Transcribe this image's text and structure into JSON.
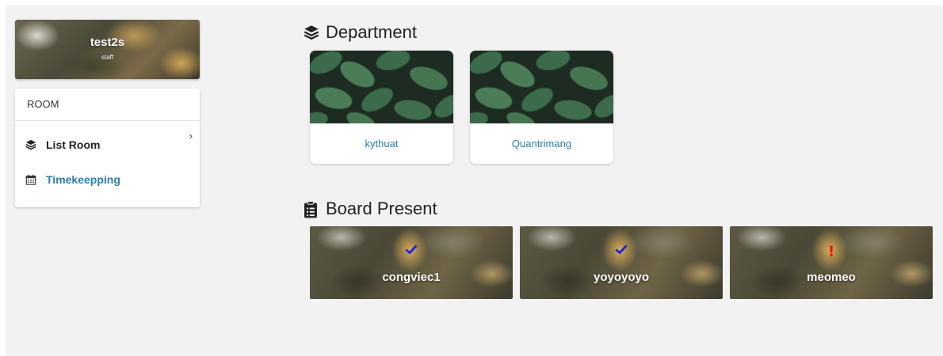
{
  "profile": {
    "name": "test2s",
    "role": "staff"
  },
  "menu": {
    "header": "ROOM",
    "items": [
      {
        "label": "List Room",
        "icon": "layers-icon"
      },
      {
        "label": "Timekeepping",
        "icon": "calendar-icon"
      }
    ],
    "active_color": "#2b7dab"
  },
  "department": {
    "title": "Department",
    "icon": "layers-icon",
    "cards": [
      {
        "name": "kythuat"
      },
      {
        "name": "Quantrimang"
      }
    ]
  },
  "board": {
    "title": "Board Present",
    "icon": "clipboard-list-icon",
    "cards": [
      {
        "name": "congviec1",
        "status": "check-icon"
      },
      {
        "name": "yoyoyoyo",
        "status": "check-icon"
      },
      {
        "name": "meomeo",
        "status": "exclamation-icon",
        "status_text": "!"
      }
    ]
  }
}
